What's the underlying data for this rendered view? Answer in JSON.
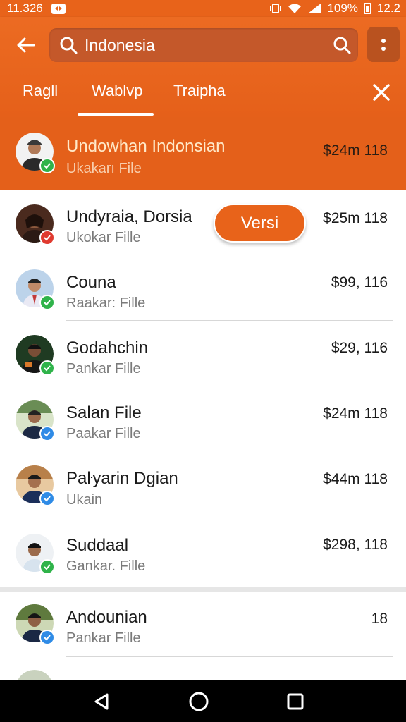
{
  "status_bar": {
    "time": "11.326",
    "battery": "109%",
    "clock_right": "12.2"
  },
  "search": {
    "value": "Indonesia"
  },
  "tabs": [
    {
      "label": "Ragll"
    },
    {
      "label": "Wablvp"
    },
    {
      "label": "Traipha"
    }
  ],
  "rows": [
    {
      "name": "Undowhan Indonsian",
      "sub": "Ukakarı File",
      "price": "$24m 118",
      "badge": "green"
    },
    {
      "name": "Undyraia, Dorsia",
      "sub": "Ukokar Fille",
      "price": "$25m 118",
      "badge": "red"
    },
    {
      "name": "Couna",
      "sub": "Raakar: Fille",
      "price": "$99, 116",
      "badge": "green"
    },
    {
      "name": "Godahchin",
      "sub": "Pankar Fille",
      "price": "$29, 116",
      "badge": "green"
    },
    {
      "name": "Salan File",
      "sub": "Paakar Fille",
      "price": "$24m 118",
      "badge": "blue"
    },
    {
      "name": "Paŀyarin Dgian",
      "sub": "Ukain",
      "price": "$44m 118",
      "badge": "blue"
    },
    {
      "name": "Suddaal",
      "sub": "Gankar. Fille",
      "price": "$298, 118",
      "badge": "green"
    },
    {
      "name": "Andounian",
      "sub": "Pankar Fille",
      "price": "18",
      "badge": "blue"
    }
  ],
  "action_button": {
    "label": "Versi"
  },
  "colors": {
    "accent": "#e8631a",
    "badge_green": "#2fb34a",
    "badge_red": "#e03a2f",
    "badge_blue": "#2f8be6"
  },
  "icons": {
    "back": "arrow-left-icon",
    "search": "search-icon",
    "menu": "more-vertical-icon",
    "close": "close-icon",
    "nav_back": "triangle-back-icon",
    "nav_home": "circle-home-icon",
    "nav_recents": "square-recents-icon"
  }
}
